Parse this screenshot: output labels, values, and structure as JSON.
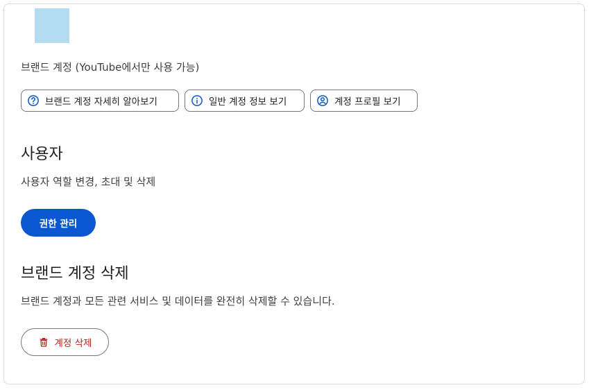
{
  "brand": {
    "avatar_color": "#b3dcf2",
    "note": "브랜드 계정 (YouTube에서만 사용 가능)"
  },
  "chips": [
    {
      "label": "브랜드 계정 자세히 알아보기",
      "icon": "help-circle-icon"
    },
    {
      "label": "일반 계정 정보 보기",
      "icon": "info-icon"
    },
    {
      "label": "계정 프로필 보기",
      "icon": "account-circle-icon"
    }
  ],
  "users": {
    "title": "사용자",
    "description": "사용자 역할 변경, 초대 및 삭제",
    "button": "권한 관리"
  },
  "delete": {
    "title": "브랜드 계정 삭제",
    "description": "브랜드 계정과 모든 관련 서비스 및 데이터를 완전히 삭제할 수 있습니다.",
    "button": "계정 삭제",
    "icon": "trash-icon"
  },
  "colors": {
    "primary": "#0b57d0",
    "danger": "#b3261e",
    "icon_blue": "#0b57d0"
  }
}
